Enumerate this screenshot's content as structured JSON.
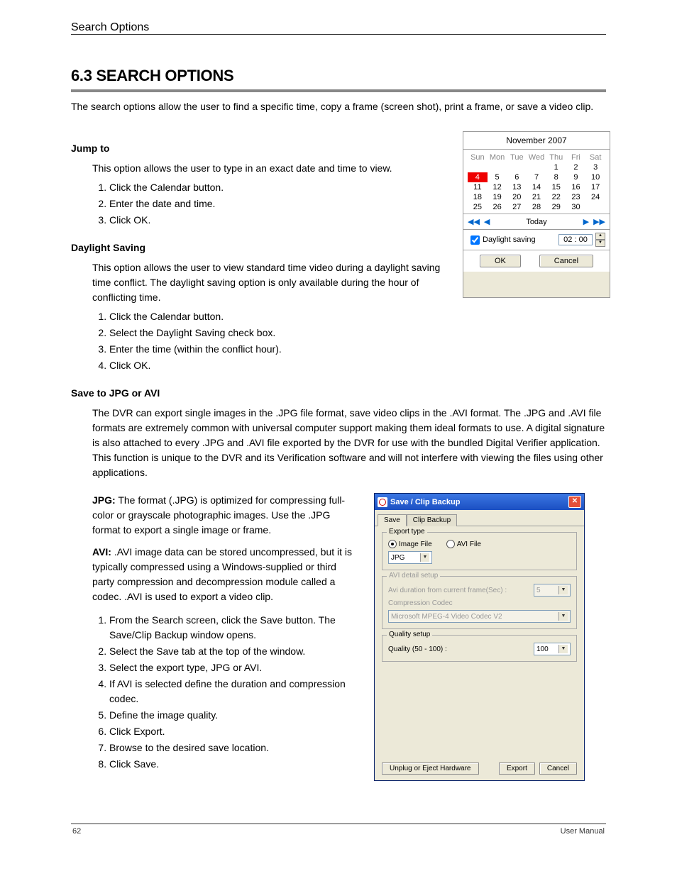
{
  "doc_title": "Search Options",
  "section_title": "6.3 SEARCH OPTIONS",
  "intro_text": "The search options allow the user to find a specific time, copy a frame (screen shot), print a frame, or save a video clip.",
  "jump_to": {
    "heading": "Jump to",
    "body": "This option allows the user to type in an exact date and time to view.",
    "list": [
      "Click the Calendar button.",
      "Enter the date and time.",
      "Click OK."
    ]
  },
  "daylight": {
    "heading": "Daylight Saving",
    "body": "This option allows the user to view standard time video during a daylight saving time conflict. The daylight saving option is only available during the hour of conflicting time."
  },
  "calendar": {
    "title": "November 2007",
    "days_hdr": [
      "Sun",
      "Mon",
      "Tue",
      "Wed",
      "Thu",
      "Fri",
      "Sat"
    ],
    "rows": [
      [
        "",
        "",
        "",
        "",
        "1",
        "2",
        "3"
      ],
      [
        "4",
        "5",
        "6",
        "7",
        "8",
        "9",
        "10"
      ],
      [
        "11",
        "12",
        "13",
        "14",
        "15",
        "16",
        "17"
      ],
      [
        "18",
        "19",
        "20",
        "21",
        "22",
        "23",
        "24"
      ],
      [
        "25",
        "26",
        "27",
        "28",
        "29",
        "30",
        ""
      ]
    ],
    "selected_row": 1,
    "selected_col": 0,
    "today": "Today",
    "daylight_label": "Daylight saving",
    "time_value": "02 : 00",
    "ok": "OK",
    "cancel": "Cancel"
  },
  "daylight_steps": {
    "list": [
      "Click the Calendar button.",
      "Select the Daylight Saving check box.",
      "Enter the time (within the conflict hour).",
      "Click OK."
    ]
  },
  "save_jpg": {
    "heading": "Save to JPG or AVI",
    "body": "The DVR can export single images in the .JPG file format, save video clips in the .AVI format. The .JPG and .AVI file formats are extremely common with universal computer support making them ideal formats to use. A digital signature is also attached to every .JPG and .AVI file exported by the DVR for use with the bundled Digital Verifier application. This function is unique to the DVR and its Verification software and will not interfere with viewing the files using other applications.",
    "jpg_label": "JPG:",
    "jpg_desc": "The format (.JPG) is optimized for compressing full-color or grayscale photographic images. Use the .JPG format to export a single image or frame.",
    "avi_label": "AVI:",
    "avi_desc": ".AVI image data can be stored uncompressed, but it is typically compressed using a Windows-supplied or third party compression and decompression module called a codec. .AVI is used to export a video clip."
  },
  "dialog": {
    "title": "Save / Clip Backup",
    "tab_save": "Save",
    "tab_clip": "Clip Backup",
    "export_type": {
      "legend": "Export type",
      "image_file": "Image File",
      "avi_file": "AVI File",
      "format_value": "JPG"
    },
    "avi_detail": {
      "legend": "AVI detail setup",
      "duration_label": "Avi duration from current frame(Sec) :",
      "duration_value": "5",
      "codec_label": "Compression Codec",
      "codec_value": "Microsoft MPEG-4 Video Codec V2"
    },
    "quality": {
      "legend": "Quality setup",
      "label": "Quality (50 - 100) :",
      "value": "100"
    },
    "unplug": "Unplug or Eject Hardware",
    "export": "Export",
    "cancel": "Cancel"
  },
  "export_steps": {
    "list": [
      "From the Search screen, click the Save button. The Save/Clip Backup window opens.",
      "Select the Save tab at the top of the window.",
      "Select the export type, JPG or AVI.",
      "If AVI is selected define the duration and compression codec.",
      "Define the image quality.",
      "Click Export.",
      "Browse to the desired save location.",
      "Click Save."
    ]
  },
  "footer": {
    "left": "62",
    "right": "User Manual"
  }
}
